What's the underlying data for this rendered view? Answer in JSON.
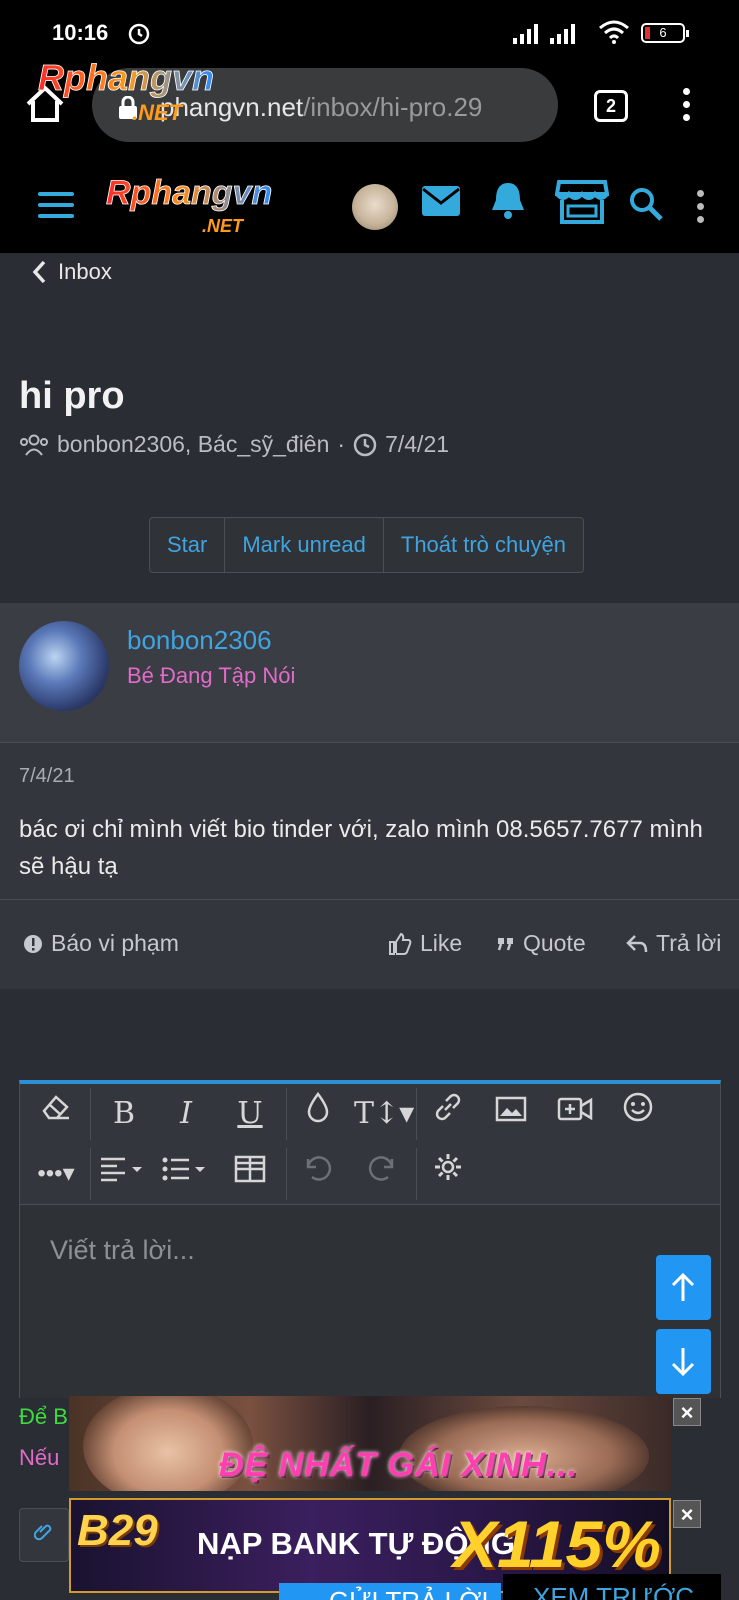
{
  "status_bar": {
    "time": "10:16",
    "battery": "6"
  },
  "browser": {
    "url_host": "phangvn.net",
    "url_path": "/inbox/hi-pro.29",
    "tab_count": "2",
    "logo_text": "Rphangvn",
    "logo_sub": ".NET"
  },
  "site_header": {
    "logo_text": "Rphangvn",
    "logo_sub": ".NET"
  },
  "breadcrumb": {
    "back_label": "Inbox"
  },
  "conversation": {
    "title": "hi pro",
    "participants": "bonbon2306, Bác_sỹ_điên",
    "separator": "·",
    "date": "7/4/21",
    "actions": [
      "Star",
      "Mark unread",
      "Thoát trò chuyện"
    ]
  },
  "message": {
    "username": "bonbon2306",
    "user_title": "Bé Đang Tập Nói",
    "date": "7/4/21",
    "body": "bác ơi chỉ mình viết bio tinder với, zalo mình 08.5657.7677 mình sẽ hậu tạ",
    "report_label": "Báo vi phạm",
    "like_label": "Like",
    "quote_label": "Quote",
    "reply_label": "Trả lời"
  },
  "editor": {
    "toolbar_row1": [
      "eraser-icon",
      "bold-icon",
      "italic-icon",
      "underline-icon",
      "color-icon",
      "text-size-icon",
      "link-icon",
      "image-icon",
      "video-icon",
      "smiley-icon"
    ],
    "toolbar_row2": [
      "more-icon",
      "align-icon",
      "list-icon",
      "table-icon",
      "undo-icon",
      "redo-icon",
      "settings-icon"
    ],
    "placeholder": "Viết trả lời..."
  },
  "notes": {
    "line1": "Để B",
    "line2": "Nếu"
  },
  "ads": {
    "ad1_text": "ĐỆ NHẤT GÁI XINH...",
    "ad2_brand": "B29",
    "ad2_text": "NẠP BANK TỰ ĐỘNG",
    "ad2_bonus": "X115%"
  },
  "footer": {
    "submit_label": "GỬI TRẢ LỜI",
    "preview_label": "XEM TRƯỚC"
  },
  "colors": {
    "accent": "#3fa4e0",
    "user_title": "#e06bc9",
    "button_blue": "#2196f3"
  }
}
